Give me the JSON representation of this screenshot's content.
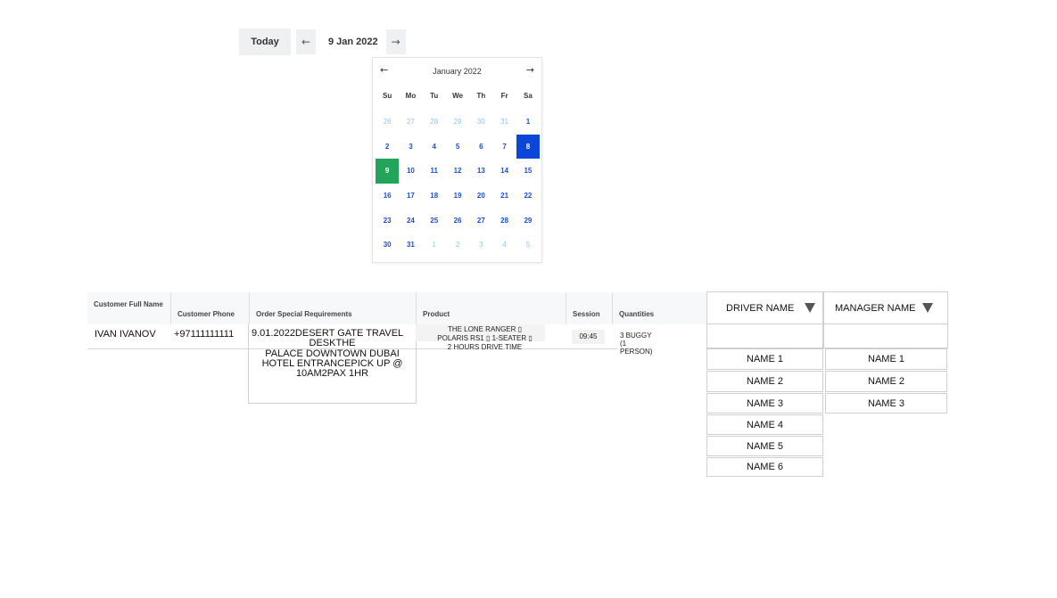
{
  "toolbar": {
    "today_label": "Today",
    "prev_icon": "←",
    "next_icon": "→",
    "current_date": "9 Jan 2022"
  },
  "calendar": {
    "title": "January 2022",
    "prev_icon": "←",
    "next_icon": "→",
    "weekdays": [
      "Su",
      "Mo",
      "Tu",
      "We",
      "Th",
      "Fr",
      "Sa"
    ],
    "days": [
      {
        "d": "26",
        "muted": true
      },
      {
        "d": "27",
        "muted": true
      },
      {
        "d": "28",
        "muted": true
      },
      {
        "d": "29",
        "muted": true
      },
      {
        "d": "30",
        "muted": true
      },
      {
        "d": "31",
        "muted": true
      },
      {
        "d": "1"
      },
      {
        "d": "2"
      },
      {
        "d": "3"
      },
      {
        "d": "4"
      },
      {
        "d": "5"
      },
      {
        "d": "6"
      },
      {
        "d": "7"
      },
      {
        "d": "8",
        "selected": true
      },
      {
        "d": "9",
        "today": true
      },
      {
        "d": "10"
      },
      {
        "d": "11"
      },
      {
        "d": "12"
      },
      {
        "d": "13"
      },
      {
        "d": "14"
      },
      {
        "d": "15"
      },
      {
        "d": "16"
      },
      {
        "d": "17"
      },
      {
        "d": "18"
      },
      {
        "d": "19"
      },
      {
        "d": "20"
      },
      {
        "d": "21"
      },
      {
        "d": "22"
      },
      {
        "d": "23"
      },
      {
        "d": "24"
      },
      {
        "d": "25"
      },
      {
        "d": "26"
      },
      {
        "d": "27"
      },
      {
        "d": "28"
      },
      {
        "d": "29"
      },
      {
        "d": "30"
      },
      {
        "d": "31"
      },
      {
        "d": "1",
        "muted": true
      },
      {
        "d": "2",
        "muted": true
      },
      {
        "d": "3",
        "muted": true
      },
      {
        "d": "4",
        "muted": true
      },
      {
        "d": "5",
        "muted": true
      }
    ],
    "colors": {
      "day": "#1d4fcf",
      "muted": "#8fc8e9",
      "selected": "#0b47d6",
      "today": "#22a55a"
    }
  },
  "table": {
    "headers": {
      "customer": "Customer Full Name",
      "phone": "Customer Phone",
      "requirements": "Order Special Requirements",
      "product": "Product",
      "session": "Session",
      "quantities": "Quantities"
    },
    "row": {
      "customer": "IVAN IVANOV",
      "phone": "+97111111111",
      "requirements_line1": "9.01.2022DESERT GATE TRAVEL",
      "requirements_line2": "DESKTHE",
      "requirements_line3": "PALACE DOWNTOWN DUBAI",
      "requirements_line4": "HOTEL ENTRANCEPICK UP @",
      "requirements_line5": "10AM2PAX 1HR",
      "product_line1": "THE LONE RANGER ▯",
      "product_line2": "POLARIS RS1 ▯ 1-SEATER ▯",
      "product_line3": "2 HOURS DRIVE TIME",
      "session": "09:45",
      "quantities": "3 BUGGY (1 PERSON)"
    }
  },
  "driver_dropdown": {
    "label": "DRIVER NAME",
    "options": [
      "NAME 1",
      "NAME 2",
      "NAME 3",
      "NAME 4",
      "NAME 5",
      "NAME 6"
    ]
  },
  "manager_dropdown": {
    "label": "MANAGER NAME",
    "options": [
      "NAME 1",
      "NAME 2",
      "NAME 3"
    ]
  }
}
